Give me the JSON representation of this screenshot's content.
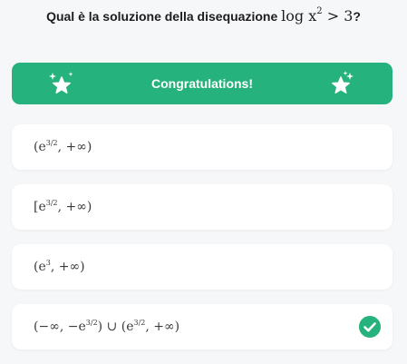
{
  "question": {
    "text": "Qual è la soluzione della disequazione",
    "math_prefix": "log x",
    "math_exponent": "2",
    "math_suffix": " > 3",
    "question_mark": "?"
  },
  "banner": {
    "title": "Congratulations!",
    "icon": "sparkle-star-icon",
    "color": "#26b27c"
  },
  "options": [
    {
      "pre": "(e",
      "exp": "3/2",
      "post": ", +∞)",
      "correct": false
    },
    {
      "pre": "[e",
      "exp": "3/2",
      "post": ", +∞)",
      "correct": false
    },
    {
      "pre": "(e",
      "exp": "3",
      "post": ", +∞)",
      "correct": false
    },
    {
      "pre": "(−∞, −e",
      "exp": "3/2",
      "mid": ") ∪ (e",
      "exp2": "3/2",
      "post": ", +∞)",
      "correct": true
    }
  ],
  "check_icon": "check-circle-icon",
  "check_color": "#26b27c"
}
